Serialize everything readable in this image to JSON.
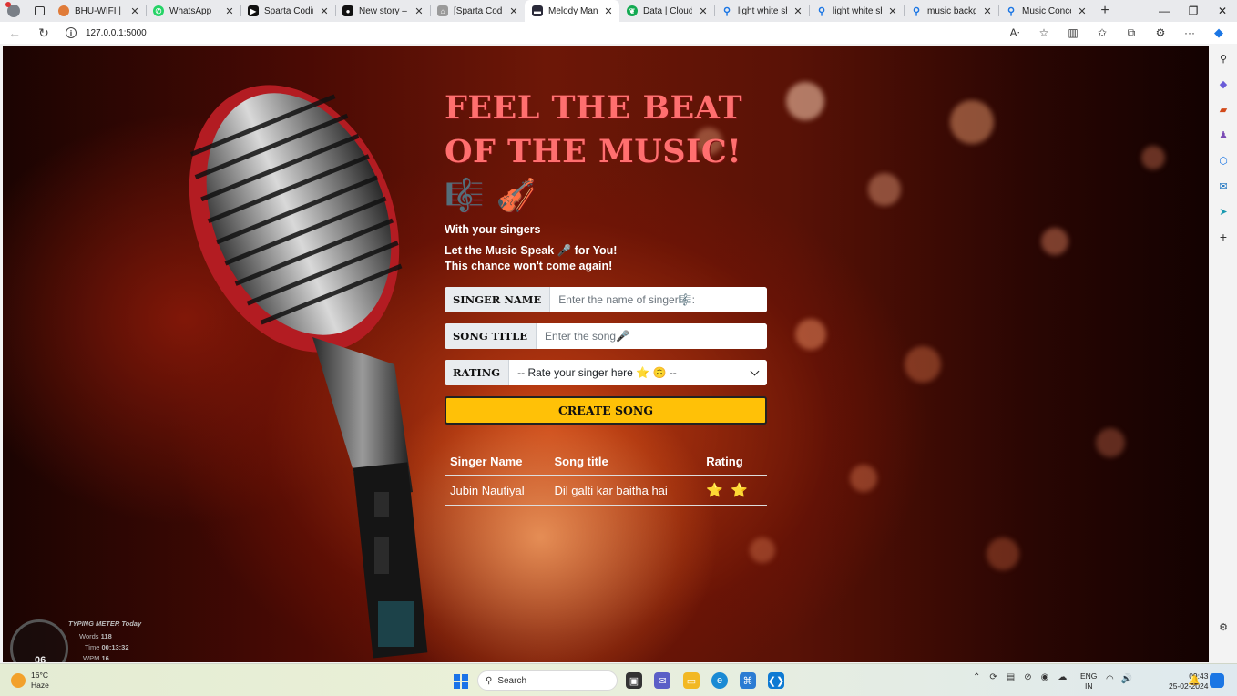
{
  "browser": {
    "tabs": [
      {
        "title": "BHU-WIFI | Login",
        "favicon_color": "#e07b39",
        "active": false
      },
      {
        "title": "WhatsApp",
        "favicon_color": "#25d366",
        "active": false
      },
      {
        "title": "Sparta Coding",
        "favicon_color": "#111111",
        "active": false
      },
      {
        "title": "New story – Me",
        "favicon_color": "#111111",
        "active": false
      },
      {
        "title": "[Sparta Coding",
        "favicon_color": "#9a9a9a",
        "active": false
      },
      {
        "title": "Melody Mania",
        "favicon_color": "#2b2b3a",
        "active": true
      },
      {
        "title": "Data | Cloud: M",
        "favicon_color": "#13aa52",
        "active": false
      },
      {
        "title": "light white shac",
        "favicon_color": "#1b76e4",
        "active": false
      },
      {
        "title": "light white shac",
        "favicon_color": "#1b76e4",
        "active": false
      },
      {
        "title": "music backgrou",
        "favicon_color": "#1b76e4",
        "active": false
      },
      {
        "title": "Music Concert",
        "favicon_color": "#1b76e4",
        "active": false
      }
    ],
    "address": "127.0.0.1:5000"
  },
  "page": {
    "headline": "FEEL THE BEAT OF THE MUSIC! 🎼 🎻",
    "subheading": "With your singers",
    "tagline_line1": "Let the Music Speak 🎤 for You!",
    "tagline_line2": "This chance won't come again!",
    "form": {
      "singer_label": "SINGER NAME",
      "singer_placeholder": "Enter the name of singer🎼:",
      "song_label": "SONG TITLE",
      "song_placeholder": "Enter the song🎤",
      "rating_label": "RATING",
      "rating_selected": "-- Rate your singer here ⭐ 🙃 --",
      "submit_label": "CREATE SONG"
    },
    "table": {
      "headers": [
        "Singer Name",
        "Song title",
        "Rating"
      ],
      "rows": [
        {
          "singer": "Jubin Nautiyal",
          "song": "Dil galti kar baitha hai",
          "rating": "⭐ ⭐"
        }
      ]
    },
    "typing_meter": {
      "title": "TYPING METER Today",
      "words_label": "Words",
      "words": "118",
      "time_label": "Time",
      "time": "00:13:32",
      "wpm_label": "WPM",
      "wpm": "16",
      "gauge": "06"
    }
  },
  "taskbar": {
    "temperature": "16°C",
    "condition": "Haze",
    "search_label": "Search",
    "language_line1": "ENG",
    "language_line2": "IN",
    "time": "09:43",
    "date": "25-02-2024"
  },
  "colors": {
    "headline": "#ff6f6f",
    "cta": "#ffc107",
    "label_bg": "#e9ecef"
  }
}
